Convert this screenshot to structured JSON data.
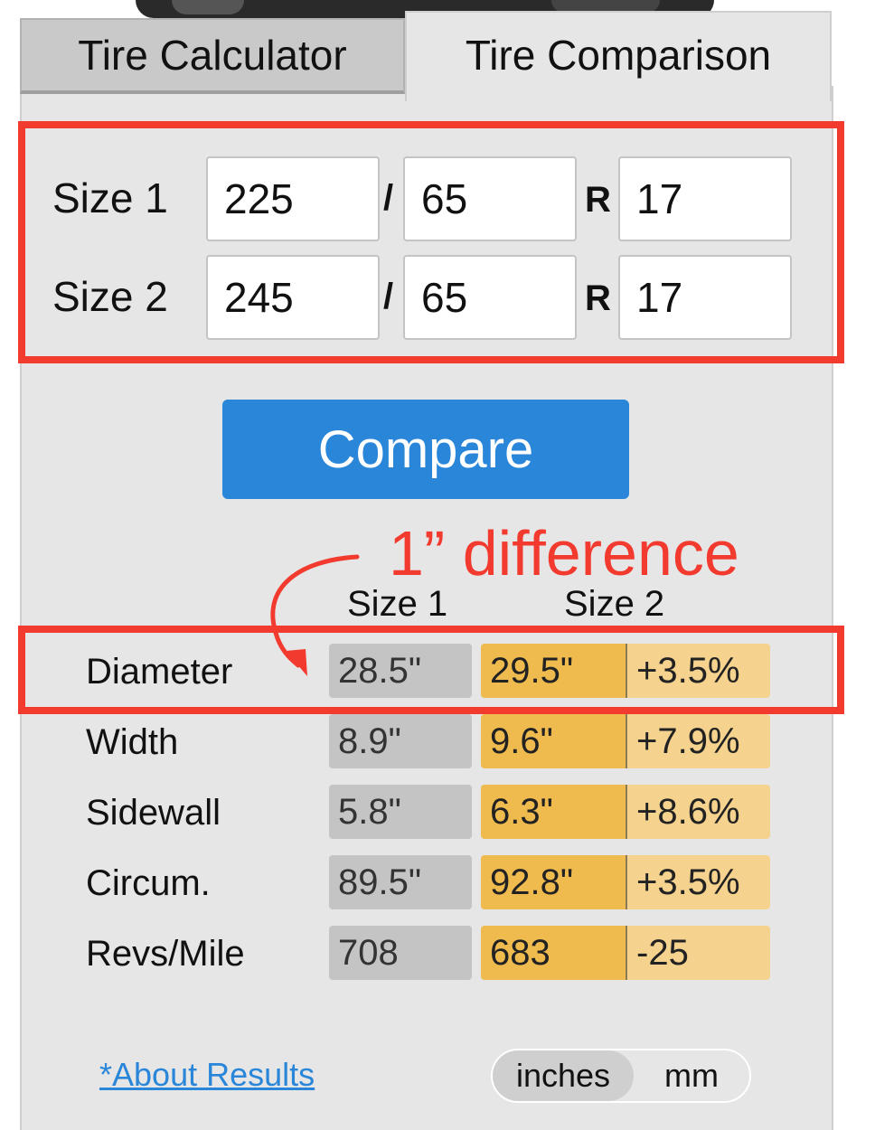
{
  "tabs": [
    {
      "label": "Tire Calculator",
      "active": false
    },
    {
      "label": "Tire Comparison",
      "active": true
    }
  ],
  "sizes": [
    {
      "label": "Size 1",
      "width": "225",
      "aspect": "65",
      "rim": "17"
    },
    {
      "label": "Size 2",
      "width": "245",
      "aspect": "65",
      "rim": "17"
    }
  ],
  "separators": {
    "slash": "/",
    "r": "R"
  },
  "compare_label": "Compare",
  "annotation": "1” difference",
  "results": {
    "headers": [
      "Size 1",
      "Size 2"
    ],
    "rows": [
      {
        "label": "Diameter",
        "size1": "28.5\"",
        "size2": "29.5\"",
        "diff": "+3.5%"
      },
      {
        "label": "Width",
        "size1": "8.9\"",
        "size2": "9.6\"",
        "diff": "+7.9%"
      },
      {
        "label": "Sidewall",
        "size1": "5.8\"",
        "size2": "6.3\"",
        "diff": "+8.6%"
      },
      {
        "label": "Circum.",
        "size1": "89.5\"",
        "size2": "92.8\"",
        "diff": "+3.5%"
      },
      {
        "label": "Revs/Mile",
        "size1": "708",
        "size2": "683",
        "diff": "-25"
      }
    ]
  },
  "about_link": "*About Results",
  "units": {
    "options": [
      "inches",
      "mm"
    ],
    "selected": "inches"
  },
  "colors": {
    "accent_blue": "#2a86d9",
    "highlight_red": "#f23a2f",
    "size2_orange": "#efbb4e",
    "diff_orange": "#f5d38f",
    "size1_gray": "#c4c4c4"
  }
}
